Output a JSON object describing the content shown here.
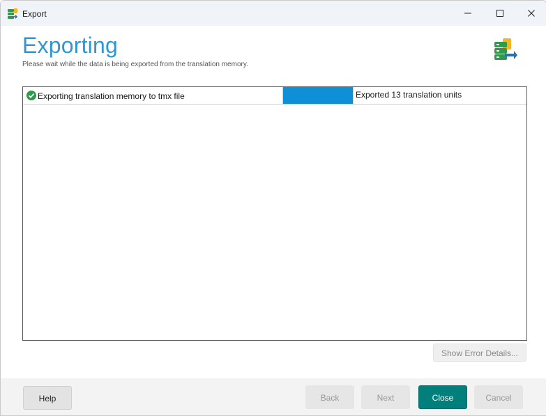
{
  "window": {
    "title": "Export",
    "controls": [
      "minimize-icon",
      "maximize-icon",
      "close-icon"
    ]
  },
  "header": {
    "title": "Exporting",
    "subtitle": "Please wait while the data is being exported from the translation memory.",
    "icon": "export-tm-icon"
  },
  "tasks": [
    {
      "status_icon": "check-circle-icon",
      "label": "Exporting translation memory to tmx file",
      "progress": 1.0,
      "status_text": "Exported 13 translation units"
    }
  ],
  "error_details_button": {
    "label": "Show Error Details...",
    "enabled": false
  },
  "footer": {
    "help_label": "Help",
    "back_label": "Back",
    "next_label": "Next",
    "close_label": "Close",
    "cancel_label": "Cancel"
  },
  "colors": {
    "accent_title": "#2f97d3",
    "progress_fill": "#0e8fd6",
    "primary_button": "#007f7c",
    "success": "#2e9a4a"
  }
}
